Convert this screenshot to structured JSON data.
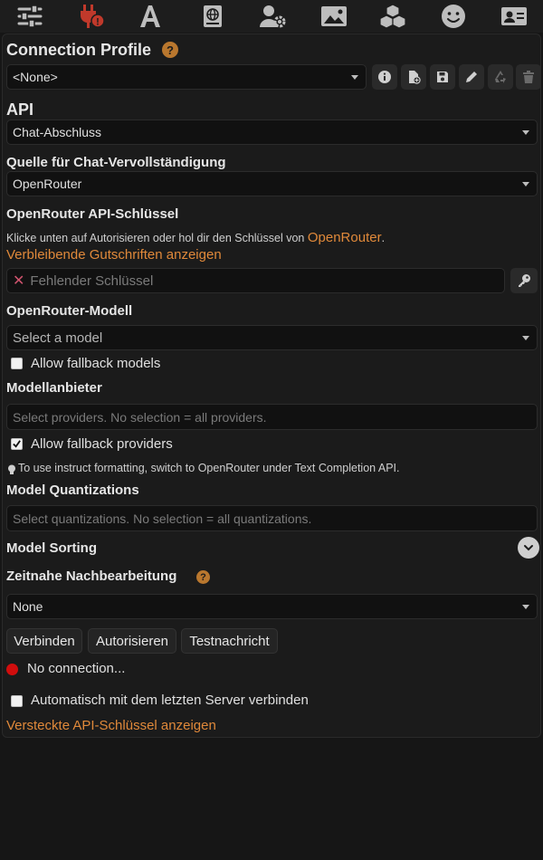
{
  "top_nav": {
    "icons": [
      "sliders-icon",
      "plug-icon",
      "font-icon",
      "globe-book-icon",
      "user-gear-icon",
      "image-icon",
      "cubes-icon",
      "smile-icon",
      "id-card-icon"
    ]
  },
  "connection_profile": {
    "title": "Connection Profile",
    "help": "?",
    "selected": "<None>"
  },
  "api": {
    "title": "API",
    "selected": "Chat-Abschluss"
  },
  "chat_source": {
    "title": "Quelle für Chat-Vervollständigung",
    "selected": "OpenRouter"
  },
  "api_key": {
    "title": "OpenRouter API-Schlüssel",
    "hint_prefix": "Klicke unten auf Autorisieren oder hol dir den Schlüssel von",
    "hint_link": "OpenRouter",
    "hint_suffix": ".",
    "credits_link": "Verbleibende Gutschriften anzeigen",
    "field_mark": "✕",
    "field_placeholder": "Fehlender Schlüssel"
  },
  "model": {
    "title": "OpenRouter-Modell",
    "placeholder": "Select a model",
    "fallback_label": "Allow fallback models",
    "fallback_checked": false
  },
  "providers": {
    "title": "Modellanbieter",
    "placeholder": "Select providers. No selection = all providers.",
    "fallback_label": "Allow fallback providers",
    "fallback_checked": true,
    "tip": "To use instruct formatting, switch to OpenRouter under Text Completion API."
  },
  "quantizations": {
    "title": "Model Quantizations",
    "placeholder": "Select quantizations. No selection = all quantizations."
  },
  "sorting": {
    "title": "Model Sorting"
  },
  "postprocessing": {
    "title": "Zeitnahe Nachbearbeitung",
    "help": "?",
    "selected": "None"
  },
  "actions": {
    "connect": "Verbinden",
    "authorize": "Autorisieren",
    "test": "Testnachricht"
  },
  "status": {
    "text": "No connection...",
    "color": "#d10d0d"
  },
  "auto_connect": {
    "label": "Automatisch mit dem letzten Server verbinden",
    "checked": false
  },
  "hidden_keys_link": "Versteckte API-Schlüssel anzeigen"
}
